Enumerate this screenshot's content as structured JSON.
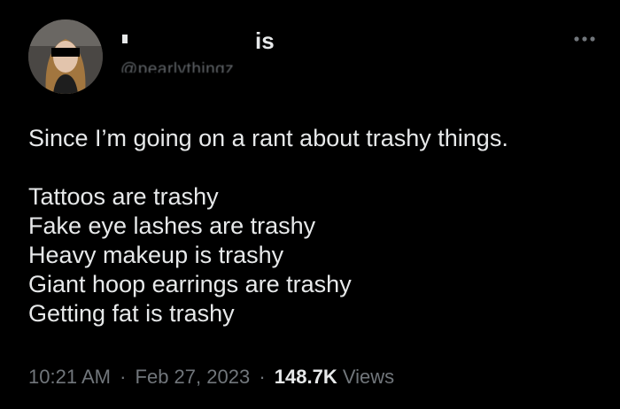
{
  "author": {
    "display_name_visible": "is",
    "handle": "@pearlythingz"
  },
  "tweet": {
    "lines": [
      "Since I’m going on a rant about trashy things.",
      "",
      "Tattoos are trashy",
      "Fake eye lashes are trashy",
      "Heavy makeup is trashy",
      "Giant hoop earrings are trashy",
      "Getting fat is trashy"
    ]
  },
  "meta": {
    "time": "10:21 AM",
    "date": "Feb 27, 2023",
    "views_count": "148.7K",
    "views_label": "Views",
    "separator": "·"
  },
  "icons": {
    "more": "more-horizontal-icon"
  },
  "colors": {
    "background": "#000000",
    "text": "#e7e9ea",
    "secondary_text": "#71767b"
  }
}
